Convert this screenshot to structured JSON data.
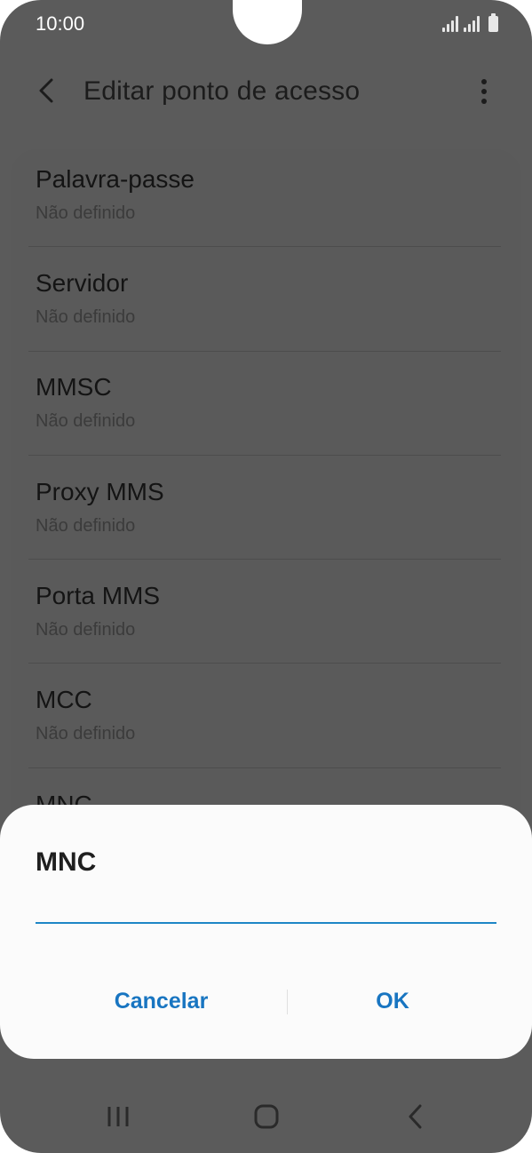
{
  "status_bar": {
    "time": "10:00"
  },
  "app_bar": {
    "title": "Editar ponto de acesso"
  },
  "settings": [
    {
      "title": "Palavra-passe",
      "value": "Não definido"
    },
    {
      "title": "Servidor",
      "value": "Não definido"
    },
    {
      "title": "MMSC",
      "value": "Não definido"
    },
    {
      "title": "Proxy MMS",
      "value": "Não definido"
    },
    {
      "title": "Porta MMS",
      "value": "Não definido"
    },
    {
      "title": "MCC",
      "value": "Não definido"
    },
    {
      "title": "MNC",
      "value": ""
    }
  ],
  "dialog": {
    "title": "MNC",
    "input_value": "",
    "cancel_label": "Cancelar",
    "ok_label": "OK"
  },
  "colors": {
    "accent": "#1875c1",
    "input_underline": "#1e86c6",
    "scrim_background": "#5b5b5b"
  },
  "icons": {
    "back": "chevron-left-icon",
    "more": "more-vert-icon",
    "nav_recents": "recents-icon",
    "nav_home": "home-icon",
    "nav_back": "back-icon"
  }
}
